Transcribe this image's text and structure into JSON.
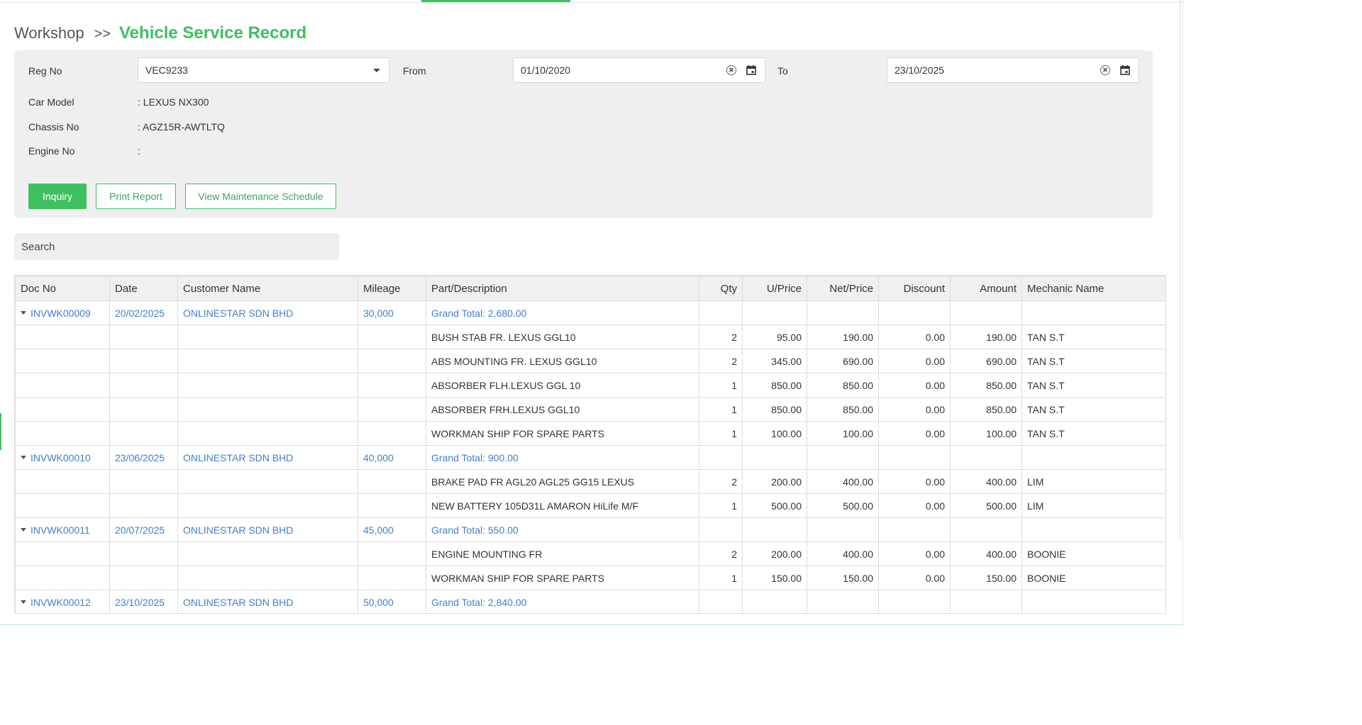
{
  "breadcrumb": {
    "parent": "Workshop",
    "separator": ">>",
    "title": "Vehicle Service Record"
  },
  "filters": {
    "reg_no_label": "Reg No",
    "reg_no_value": "VEC9233",
    "from_label": "From",
    "from_value": "01/10/2020",
    "to_label": "To",
    "to_value": "23/10/2025"
  },
  "vehicle": {
    "car_model_label": "Car Model",
    "car_model_value": ": LEXUS NX300",
    "chassis_label": "Chassis No",
    "chassis_value": ": AGZ15R-AWTLTQ",
    "engine_label": "Engine No",
    "engine_value": ":"
  },
  "buttons": {
    "inquiry": "Inquiry",
    "print_report": "Print Report",
    "view_schedule": "View Maintenance Schedule"
  },
  "search": {
    "placeholder": "Search"
  },
  "table": {
    "columns": [
      "Doc No",
      "Date",
      "Customer Name",
      "Mileage",
      "Part/Description",
      "Qty",
      "U/Price",
      "Net/Price",
      "Discount",
      "Amount",
      "Mechanic Name"
    ],
    "groups": [
      {
        "doc_no": "INVWK00009",
        "date": "20/02/2025",
        "customer": "ONLINESTAR SDN BHD",
        "mileage": "30,000",
        "grand_total": "Grand Total: 2,680.00",
        "items": [
          {
            "part": "BUSH STAB FR. LEXUS GGL10",
            "qty": "2",
            "uprice": "95.00",
            "net": "190.00",
            "discount": "0.00",
            "amount": "190.00",
            "mechanic": "TAN S.T"
          },
          {
            "part": "ABS MOUNTING FR. LEXUS GGL10",
            "qty": "2",
            "uprice": "345.00",
            "net": "690.00",
            "discount": "0.00",
            "amount": "690.00",
            "mechanic": "TAN S.T"
          },
          {
            "part": "ABSORBER FLH.LEXUS GGL 10",
            "qty": "1",
            "uprice": "850.00",
            "net": "850.00",
            "discount": "0.00",
            "amount": "850.00",
            "mechanic": "TAN S.T"
          },
          {
            "part": "ABSORBER FRH.LEXUS GGL10",
            "qty": "1",
            "uprice": "850.00",
            "net": "850.00",
            "discount": "0.00",
            "amount": "850.00",
            "mechanic": "TAN S.T"
          },
          {
            "part": "WORKMAN SHIP FOR SPARE PARTS",
            "qty": "1",
            "uprice": "100.00",
            "net": "100.00",
            "discount": "0.00",
            "amount": "100.00",
            "mechanic": "TAN S.T"
          }
        ]
      },
      {
        "doc_no": "INVWK00010",
        "date": "23/06/2025",
        "customer": "ONLINESTAR SDN BHD",
        "mileage": "40,000",
        "grand_total": "Grand Total: 900.00",
        "items": [
          {
            "part": "BRAKE PAD FR AGL20 AGL25 GG15 LEXUS",
            "qty": "2",
            "uprice": "200.00",
            "net": "400.00",
            "discount": "0.00",
            "amount": "400.00",
            "mechanic": "LIM"
          },
          {
            "part": "NEW BATTERY 105D31L AMARON HiLife M/F",
            "qty": "1",
            "uprice": "500.00",
            "net": "500.00",
            "discount": "0.00",
            "amount": "500.00",
            "mechanic": "LIM"
          }
        ]
      },
      {
        "doc_no": "INVWK00011",
        "date": "20/07/2025",
        "customer": "ONLINESTAR SDN BHD",
        "mileage": "45,000",
        "grand_total": "Grand Total: 550.00",
        "items": [
          {
            "part": "ENGINE MOUNTING FR",
            "qty": "2",
            "uprice": "200.00",
            "net": "400.00",
            "discount": "0.00",
            "amount": "400.00",
            "mechanic": "BOONIE"
          },
          {
            "part": "WORKMAN SHIP FOR SPARE PARTS",
            "qty": "1",
            "uprice": "150.00",
            "net": "150.00",
            "discount": "0.00",
            "amount": "150.00",
            "mechanic": "BOONIE"
          }
        ]
      },
      {
        "doc_no": "INVWK00012",
        "date": "23/10/2025",
        "customer": "ONLINESTAR SDN BHD",
        "mileage": "50,000",
        "grand_total": "Grand Total: 2,840.00",
        "items": []
      }
    ]
  },
  "colors": {
    "accent": "#3fc060",
    "link": "#3f7fd0",
    "panel": "#efefef"
  },
  "icons": {
    "clear": "clear-circle-icon",
    "calendar": "calendar-icon",
    "dropdown": "chevron-down-icon",
    "expand": "expand-triangle-icon"
  }
}
